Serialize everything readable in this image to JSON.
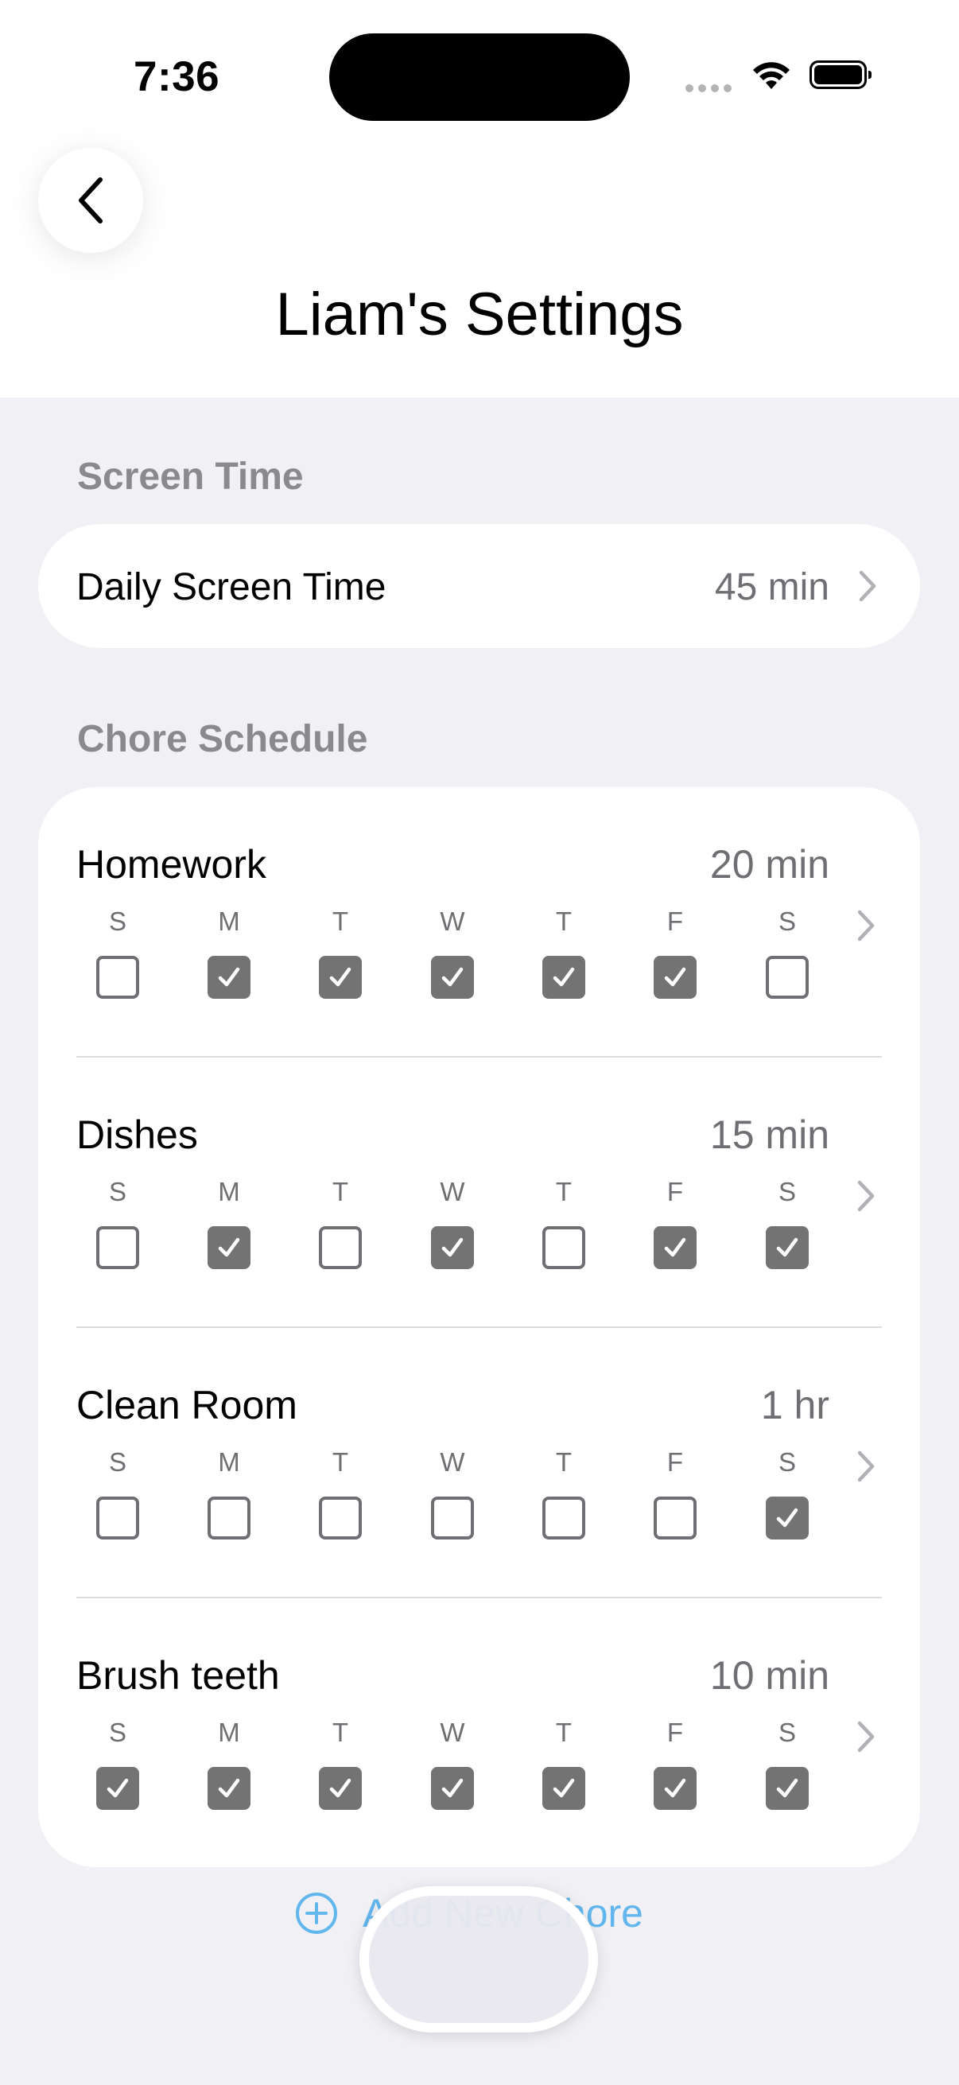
{
  "status_bar": {
    "time": "7:36"
  },
  "header": {
    "title": "Liam's Settings"
  },
  "screen_time": {
    "section_label": "Screen Time",
    "row_label": "Daily Screen Time",
    "row_value": "45 min"
  },
  "chores": {
    "section_label": "Chore Schedule",
    "day_letters": [
      "S",
      "M",
      "T",
      "W",
      "T",
      "F",
      "S"
    ],
    "items": [
      {
        "name": "Homework",
        "duration": "20 min",
        "days": [
          false,
          true,
          true,
          true,
          true,
          true,
          false
        ]
      },
      {
        "name": "Dishes",
        "duration": "15 min",
        "days": [
          false,
          true,
          false,
          true,
          false,
          true,
          true
        ]
      },
      {
        "name": "Clean Room",
        "duration": "1 hr",
        "days": [
          false,
          false,
          false,
          false,
          false,
          false,
          true
        ]
      },
      {
        "name": "Brush teeth",
        "duration": "10 min",
        "days": [
          true,
          true,
          true,
          true,
          true,
          true,
          true
        ]
      }
    ],
    "add_label": "Add New Chore"
  },
  "colors": {
    "accent_blue": "#62b6ee",
    "checked_box": "#737373",
    "background": "#f0f0f5"
  },
  "icons": {
    "back": "chevron-left-icon",
    "row_chevron": "chevron-right-icon",
    "add": "plus-circle-icon"
  }
}
